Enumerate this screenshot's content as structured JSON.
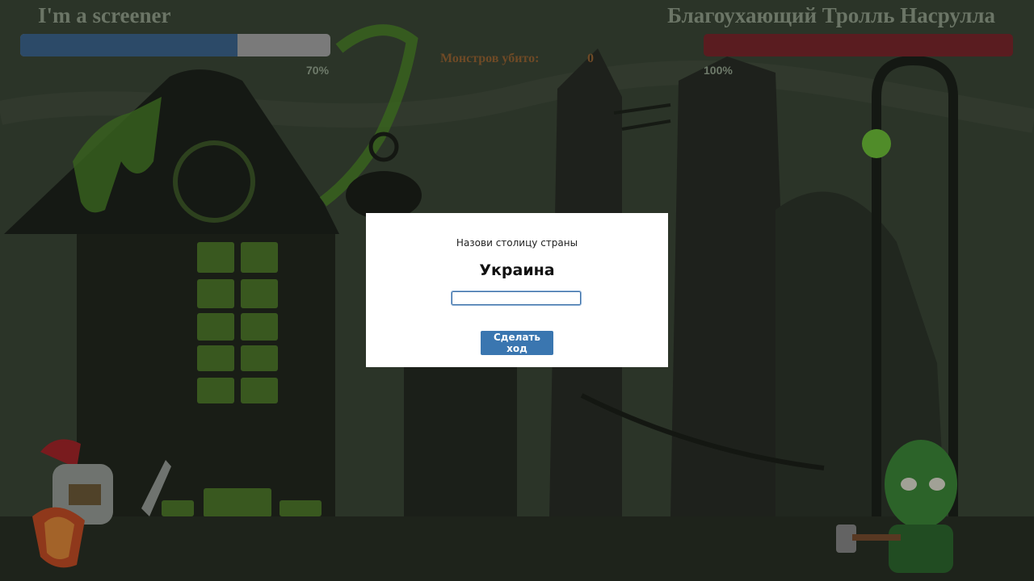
{
  "player": {
    "name": "I'm a screener",
    "health_percent": 70,
    "health_label": "70%",
    "bar_color": "#2c4a68"
  },
  "enemy": {
    "name": "Благоухающий Тролль Насрулла",
    "health_percent": 100,
    "health_label": "100%",
    "bar_color": "#5a1c20"
  },
  "kills": {
    "label": "Монстров убито:",
    "value": "0"
  },
  "modal": {
    "prompt": "Назови столицу страны",
    "country": "Украина",
    "answer_value": "",
    "submit_label": "Сделать ход"
  },
  "scene": {
    "background": "haunted-forest-night",
    "slime_color": "#4f8a2a",
    "lamp_color": "#6fc23a"
  }
}
